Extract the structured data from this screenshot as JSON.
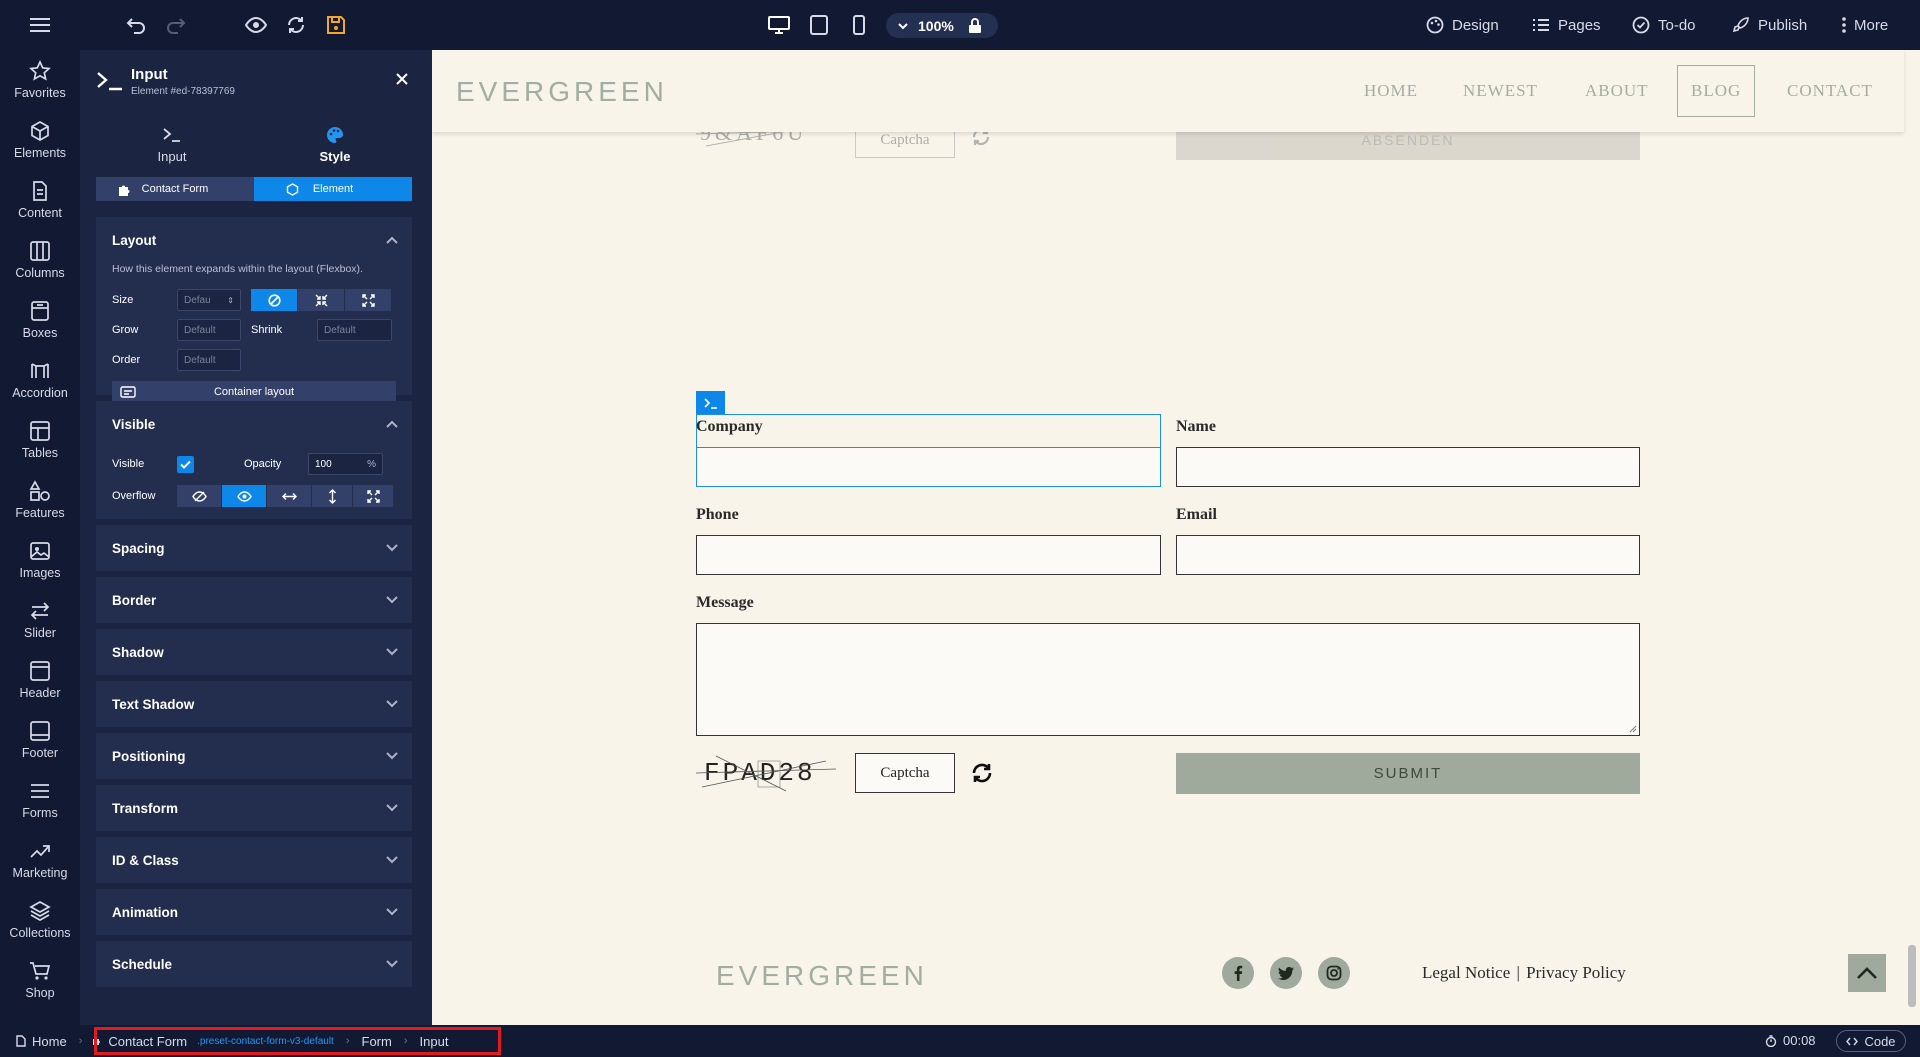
{
  "topbar": {
    "zoom": "100%",
    "design": "Design",
    "pages": "Pages",
    "todo": "To-do",
    "publish": "Publish",
    "more": "More"
  },
  "rail": [
    "Favorites",
    "Elements",
    "Content",
    "Columns",
    "Boxes",
    "Accordion",
    "Tables",
    "Features",
    "Images",
    "Slider",
    "Header",
    "Footer",
    "Forms",
    "Marketing",
    "Collections",
    "Shop"
  ],
  "panel": {
    "title": "Input",
    "subtitle": "Element #ed-78397769",
    "tab_input": "Input",
    "tab_style": "Style",
    "seg_contact": "Contact Form",
    "seg_element": "Element",
    "layout": {
      "title": "Layout",
      "desc": "How this element expands within the layout (Flexbox).",
      "size": "Size",
      "size_val": "Defau",
      "grow": "Grow",
      "shrink": "Shrink",
      "order": "Order",
      "default": "Default",
      "container": "Container layout"
    },
    "visible": {
      "title": "Visible",
      "visible": "Visible",
      "opacity": "Opacity",
      "opacity_val": "100",
      "pct": "%",
      "overflow": "Overflow"
    },
    "sections": [
      "Spacing",
      "Border",
      "Shadow",
      "Text Shadow",
      "Positioning",
      "Transform",
      "ID & Class",
      "Animation",
      "Schedule"
    ]
  },
  "site": {
    "logo": "EVERGREEN",
    "nav": [
      "HOME",
      "NEWEST",
      "ABOUT",
      "BLOG",
      "CONTACT"
    ],
    "ghost_captcha": "Captcha",
    "ghost_submit": "ABSENDEN",
    "form": {
      "company": "Company",
      "name": "Name",
      "phone": "Phone",
      "email": "Email",
      "message": "Message",
      "captcha_placeholder": "Captcha",
      "captcha_code": "FPAD28",
      "submit": "SUBMIT"
    },
    "footer_logo": "EVERGREEN",
    "legal": "Legal Notice",
    "privacy": "Privacy Policy",
    "sep": "|"
  },
  "bottombar": {
    "home": "Home",
    "contact_form": "Contact Form",
    "preset": ".preset-contact-form-v3-default",
    "form": "Form",
    "input": "Input",
    "timer": "00:08",
    "code": "Code"
  }
}
